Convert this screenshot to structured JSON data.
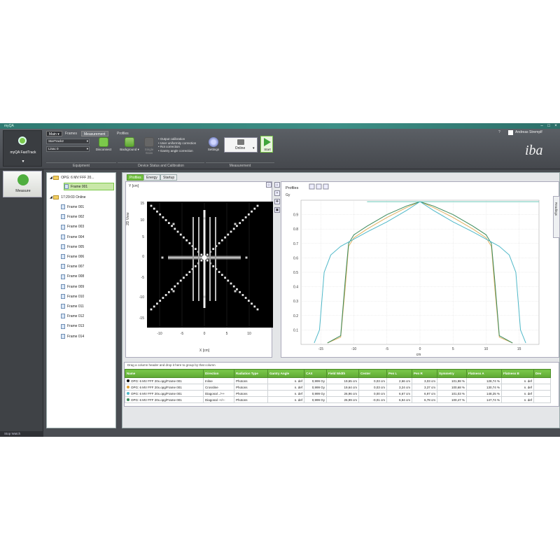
{
  "window": {
    "title": "myQA"
  },
  "ribbon": {
    "tabs": [
      "Main ▾",
      "Frames",
      "Measurement",
      "Profiles"
    ],
    "app_button_label": "myQA FastTrack",
    "device_combo": "StarTrack2",
    "linac_combo": "Linac 0",
    "disconnect_label": "Disconnect",
    "background_label": "Background",
    "single_label": "Single Scan",
    "bullets": [
      "Output calibration",
      "User uniformity correction",
      "Rot correction",
      "Gantry angle correction"
    ],
    "settings_label": "Settings",
    "mode_combo": "Online",
    "start_label": "Start",
    "groups": [
      "Equipment",
      "Device Status and Calibration",
      "Measurement"
    ],
    "user": "Andreas Stremplf",
    "logo": "iba"
  },
  "leftnav": {
    "measure_label": "Measure",
    "statusbar": "Stop Watch"
  },
  "tree": {
    "root1": "OPG: 6 MV FFF 20...",
    "root1_child": "Frame 001",
    "root2": "17:29:03 Online",
    "frames": [
      "Frame 001",
      "Frame 002",
      "Frame 003",
      "Frame 004",
      "Frame 005",
      "Frame 006",
      "Frame 007",
      "Frame 008",
      "Frame 009",
      "Frame 010",
      "Frame 011",
      "Frame 012",
      "Frame 013",
      "Frame 014"
    ]
  },
  "workspace": {
    "tabs": [
      "Profiles",
      "Energy",
      "Startup"
    ],
    "image_ylabel": "Y [cm]",
    "image_xlabel": "X [cm]",
    "image_side_label": "2D View",
    "profiles_title": "Profiles",
    "profiles_unit": "Gy",
    "profiles_xlabel": "cm",
    "readings_label": "Readings",
    "image_ticks": [
      "-10",
      "-5",
      "0",
      "5",
      "10"
    ],
    "image_yticks": [
      "15",
      "10",
      "5",
      "0",
      "-5",
      "-10",
      "-15"
    ],
    "profile_yticks": [
      "0.9",
      "0.8",
      "0.7",
      "0.6",
      "0.5",
      "0.4",
      "0.3",
      "0.2",
      "0.1"
    ],
    "profile_xticks": [
      "-15",
      "-10",
      "-5",
      "0",
      "5",
      "10",
      "15"
    ]
  },
  "chart_data": {
    "type": "line",
    "title": "Profiles",
    "xlabel": "cm",
    "ylabel": "Gy",
    "xlim": [
      -18,
      18
    ],
    "ylim": [
      0,
      1.0
    ],
    "series": [
      {
        "color": "#e0b060",
        "x": [
          -14,
          -12,
          -11.3,
          -10.8,
          -10,
          -8,
          -5,
          -2,
          0,
          2,
          5,
          8,
          10,
          10.8,
          11.3,
          12,
          14
        ],
        "y": [
          0.01,
          0.05,
          0.4,
          0.68,
          0.74,
          0.8,
          0.88,
          0.95,
          0.99,
          0.95,
          0.88,
          0.8,
          0.74,
          0.68,
          0.4,
          0.05,
          0.01
        ]
      },
      {
        "color": "#3a8a5a",
        "x": [
          -14,
          -12,
          -11.3,
          -10.8,
          -10,
          -8,
          -5,
          -2,
          0,
          2,
          5,
          8,
          10,
          10.8,
          11.3,
          12,
          14
        ],
        "y": [
          0.01,
          0.06,
          0.45,
          0.7,
          0.76,
          0.82,
          0.9,
          0.96,
          0.99,
          0.96,
          0.9,
          0.82,
          0.76,
          0.7,
          0.45,
          0.06,
          0.01
        ]
      },
      {
        "color": "#4fb8c8",
        "x": [
          -16,
          -15.2,
          -14.5,
          -13.5,
          -12,
          -10,
          -8,
          -5,
          -2,
          0,
          2,
          5,
          8,
          10,
          12,
          13.5,
          14.5,
          15.2,
          16
        ],
        "y": [
          0.01,
          0.1,
          0.5,
          0.62,
          0.68,
          0.73,
          0.78,
          0.85,
          0.93,
          0.99,
          0.93,
          0.85,
          0.78,
          0.73,
          0.68,
          0.62,
          0.5,
          0.1,
          0.01
        ]
      },
      {
        "color": "#66c8b8",
        "x": [
          -8,
          -4,
          0,
          4,
          8,
          12,
          16,
          18
        ],
        "y": [
          0.99,
          0.99,
          0.99,
          0.99,
          0.99,
          0.99,
          0.99,
          0.99
        ]
      }
    ]
  },
  "grid": {
    "hint": "Drag a column header and drop it here to group by that column",
    "columns": [
      "Name",
      "Direction",
      "Radiation Type",
      "Gantry Angle",
      "CAX",
      "Field Width",
      "Center",
      "Pen L",
      "Pen R",
      "Symmetry",
      "Flatness A",
      "Flatness B",
      "Dev"
    ],
    "rows": [
      {
        "dot": "#111111",
        "cells": [
          "OPG: 6 MV FFF 20x.opg/Frame 001",
          "Inline",
          "Photons",
          "n. def",
          "0,999 Gy",
          "19,65 cm",
          "0,03 cm",
          "2,66 cm",
          "3,03 cm",
          "101,98 %",
          "128,74 %",
          "n. def",
          ""
        ]
      },
      {
        "dot": "#e0a030",
        "cells": [
          "OPG: 6 MV FFF 20x.opg/Frame 001",
          "Crossline",
          "Photons",
          "n. def",
          "0,999 Gy",
          "19,64 cm",
          "0,03 cm",
          "3,24 cm",
          "3,37 cm",
          "100,68 %",
          "130,74 %",
          "n. def",
          ""
        ]
      },
      {
        "dot": "#4fb8c8",
        "cells": [
          "OPG: 6 MV FFF 20x.opg/Frame 001",
          "Diagonal ../++",
          "Photons",
          "n. def",
          "0,999 Gy",
          "26,96 cm",
          "0,00 cm",
          "6,67 cm",
          "6,97 cm",
          "101,03 %",
          "148,25 %",
          "n. def",
          ""
        ]
      },
      {
        "dot": "#3a8a5a",
        "cells": [
          "OPG: 6 MV FFF 20x.opg/Frame 001",
          "Diagonal -+/+-",
          "Photons",
          "n. def",
          "0,999 Gy",
          "26,99 cm",
          "-0,01 cm",
          "6,94 cm",
          "6,78 cm",
          "100,47 %",
          "147,74 %",
          "n. def",
          ""
        ]
      }
    ]
  }
}
